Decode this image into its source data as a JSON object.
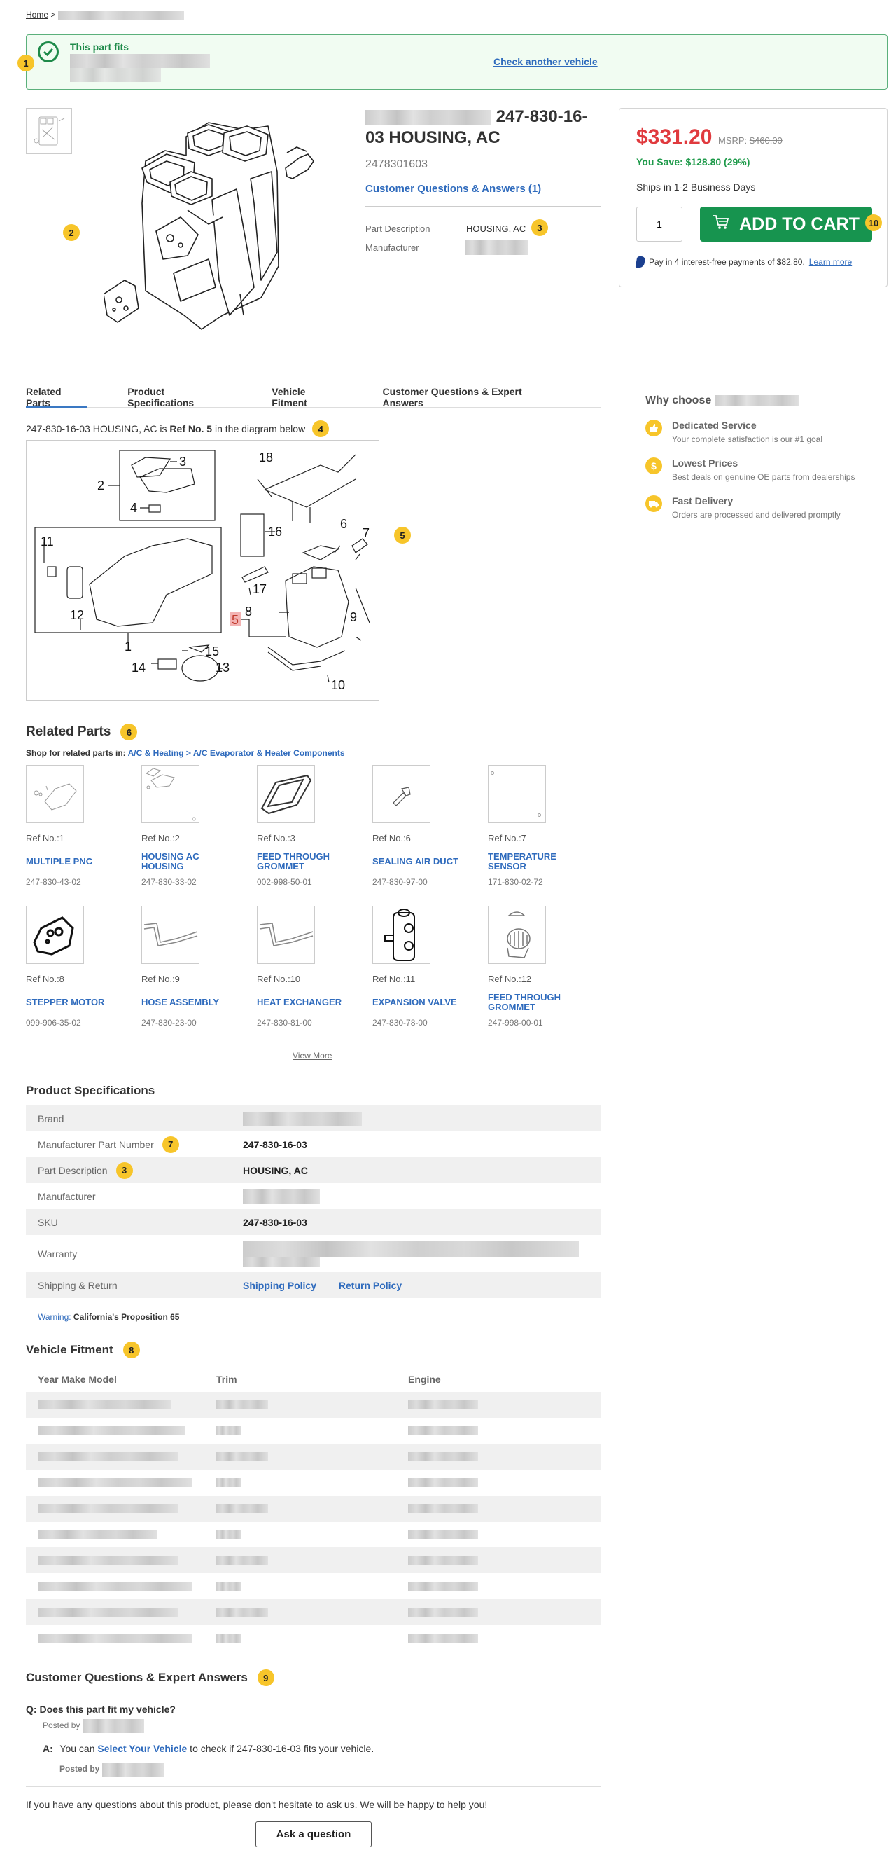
{
  "breadcrumb": {
    "home": "Home",
    "separator": ">"
  },
  "fit_banner": {
    "title": "This part fits",
    "check_link": "Check another vehicle"
  },
  "badges": {
    "b1": "1",
    "b2": "2",
    "b3": "3",
    "b4": "4",
    "b5": "5",
    "b6": "6",
    "b7": "7",
    "b8": "8",
    "b9": "9",
    "b10": "10"
  },
  "product": {
    "title_suffix": "247-830-16-03 HOUSING, AC",
    "sku": "2478301603",
    "qa_link": "Customer Questions & Answers (1)",
    "part_description_label": "Part Description",
    "part_description_value": "HOUSING, AC",
    "manufacturer_label": "Manufacturer"
  },
  "pricing": {
    "price": "$331.20",
    "msrp_label": "MSRP:",
    "msrp_value": "$460.00",
    "you_save": "You Save: $128.80 (29%)",
    "ships": "Ships in 1-2 Business Days",
    "quantity": "1",
    "add_to_cart": "ADD TO CART",
    "paypal_text": "Pay in 4 interest-free payments of $82.80.",
    "paypal_link": "Learn more"
  },
  "tabs": [
    {
      "label": "Related Parts",
      "active": true
    },
    {
      "label": "Product Specifications"
    },
    {
      "label": "Vehicle Fitment"
    },
    {
      "label": "Customer Questions & Expert Answers"
    }
  ],
  "diagram_ref": {
    "prefix": "247-830-16-03 HOUSING, AC is ",
    "ref": "Ref No. 5",
    "suffix": " in the diagram below"
  },
  "diagram_labels": [
    "1",
    "2",
    "3",
    "4",
    "5",
    "6",
    "7",
    "8",
    "9",
    "10",
    "11",
    "12",
    "13",
    "14",
    "15",
    "16",
    "17",
    "18"
  ],
  "why_choose": {
    "title": "Why choose",
    "items": [
      {
        "icon": "thumbs-up-icon",
        "glyph": "👍",
        "title": "Dedicated Service",
        "desc": "Your complete satisfaction is our #1 goal"
      },
      {
        "icon": "dollar-icon",
        "glyph": "$",
        "title": "Lowest Prices",
        "desc": "Best deals on genuine OE parts from dealerships"
      },
      {
        "icon": "truck-icon",
        "glyph": "▬",
        "title": "Fast Delivery",
        "desc": "Orders are processed and delivered promptly"
      }
    ]
  },
  "related_parts": {
    "title": "Related Parts",
    "shop_label": "Shop for related parts in:",
    "shop_link": "A/C & Heating > A/C Evaporator & Heater Components",
    "items": [
      {
        "ref": "Ref No.:1",
        "name": "MULTIPLE PNC",
        "pn": "247-830-43-02"
      },
      {
        "ref": "Ref No.:2",
        "name": "HOUSING AC HOUSING",
        "pn": "247-830-33-02"
      },
      {
        "ref": "Ref No.:3",
        "name": "FEED THROUGH GROMMET",
        "pn": "002-998-50-01"
      },
      {
        "ref": "Ref No.:6",
        "name": "SEALING AIR DUCT",
        "pn": "247-830-97-00"
      },
      {
        "ref": "Ref No.:7",
        "name": "TEMPERATURE SENSOR",
        "pn": "171-830-02-72"
      },
      {
        "ref": "Ref No.:8",
        "name": "STEPPER MOTOR",
        "pn": "099-906-35-02"
      },
      {
        "ref": "Ref No.:9",
        "name": "HOSE ASSEMBLY",
        "pn": "247-830-23-00"
      },
      {
        "ref": "Ref No.:10",
        "name": "HEAT EXCHANGER",
        "pn": "247-830-81-00"
      },
      {
        "ref": "Ref No.:11",
        "name": "EXPANSION VALVE",
        "pn": "247-830-78-00"
      },
      {
        "ref": "Ref No.:12",
        "name": "FEED THROUGH GROMMET",
        "pn": "247-998-00-01"
      }
    ],
    "view_more": "View More"
  },
  "specs": {
    "title": "Product Specifications",
    "rows": [
      {
        "label": "Brand",
        "value": null
      },
      {
        "label": "Manufacturer Part Number",
        "value": "247-830-16-03"
      },
      {
        "label": "Part Description",
        "value": "HOUSING, AC"
      },
      {
        "label": "Manufacturer",
        "value": null
      },
      {
        "label": "SKU",
        "value": "247-830-16-03"
      },
      {
        "label": "Warranty",
        "value": null
      },
      {
        "label": "Shipping & Return",
        "links": [
          "Shipping Policy",
          "Return Policy"
        ]
      }
    ],
    "warning_label": "Warning:",
    "warning_text": "California's Proposition 65"
  },
  "fitment": {
    "title": "Vehicle Fitment",
    "headers": [
      "Year Make Model",
      "Trim",
      "Engine"
    ],
    "row_count": 10
  },
  "qa": {
    "title": "Customer Questions & Expert Answers",
    "q_prefix": "Q:",
    "question": "Does this part fit my vehicle?",
    "posted_by": "Posted by",
    "a_prefix": "A:",
    "answer_pre": "You can ",
    "answer_link": "Select Your Vehicle",
    "answer_post": " to check if 247-830-16-03 fits your vehicle.",
    "footer": "If you have any questions about this product, please don't hesitate to ask us. We will be happy to help you!",
    "ask_button": "Ask a question"
  }
}
